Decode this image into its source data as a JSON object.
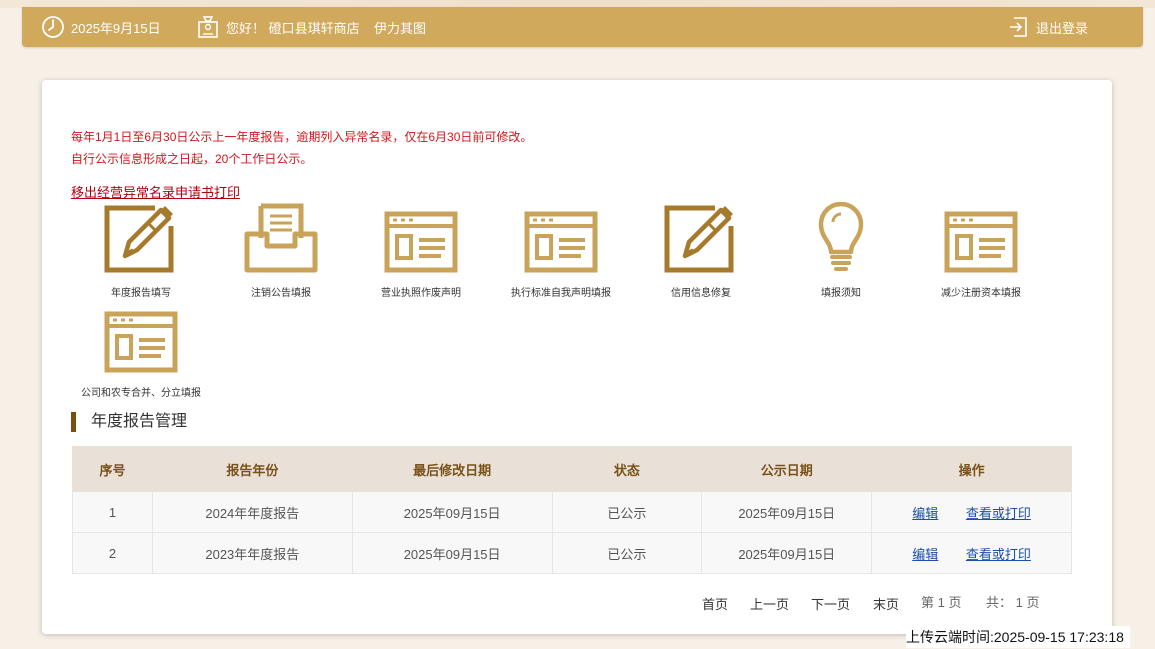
{
  "topbar": {
    "date": "2025年9月15日",
    "greeting": "您好！ 磴口县琪轩商店",
    "map_label": "伊力其图",
    "logout_label": "退出登录"
  },
  "notice": {
    "line1": "每年1月1日至6月30日公示上一年度报告，逾期列入异常名录，仅在6月30日前可修改。",
    "line2": "自行公示信息形成之日起，20个工作日公示。",
    "apply_link": "移出经营异常名录申请书打印"
  },
  "tiles": [
    {
      "label": "年度报告填写",
      "icon": "edit-pencil-icon"
    },
    {
      "label": "注销公告填报",
      "icon": "inbox-tray-icon"
    },
    {
      "label": "营业执照作废声明",
      "icon": "document-form-icon"
    },
    {
      "label": "执行标准自我声明填报",
      "icon": "document-form-icon"
    },
    {
      "label": "信用信息修复",
      "icon": "edit-pencil-icon"
    },
    {
      "label": "填报须知",
      "icon": "lightbulb-icon"
    },
    {
      "label": "减少注册资本填报",
      "icon": "document-form-icon"
    },
    {
      "label": "公司和农专合并、分立填报",
      "icon": "document-form-icon"
    }
  ],
  "section_title": "年度报告管理",
  "table": {
    "headers": [
      "序号",
      "报告年份",
      "最后修改日期",
      "状态",
      "公示日期",
      "操作"
    ],
    "rows": [
      {
        "no": "1",
        "year": "2024年年度报告",
        "modified": "2025年09月15日",
        "status": "已公示",
        "published": "2025年09月15日",
        "edit": "编辑",
        "view": "查看或打印"
      },
      {
        "no": "2",
        "year": "2023年年度报告",
        "modified": "2025年09月15日",
        "status": "已公示",
        "published": "2025年09月15日",
        "edit": "编辑",
        "view": "查看或打印"
      }
    ]
  },
  "pager": {
    "first": "首页",
    "prev": "上一页",
    "next": "下一页",
    "last": "末页",
    "page_info": "第 1 页",
    "total_info": "共： 1 页"
  },
  "upload_time": "上传云端时间:2025-09-15 17:23:18",
  "colors": {
    "gold": "#d1a95c",
    "icon_dark": "#a57a2c",
    "icon_light": "#c9a35a",
    "notice_red": "#d2161c",
    "link_blue": "#1c4fa8"
  }
}
